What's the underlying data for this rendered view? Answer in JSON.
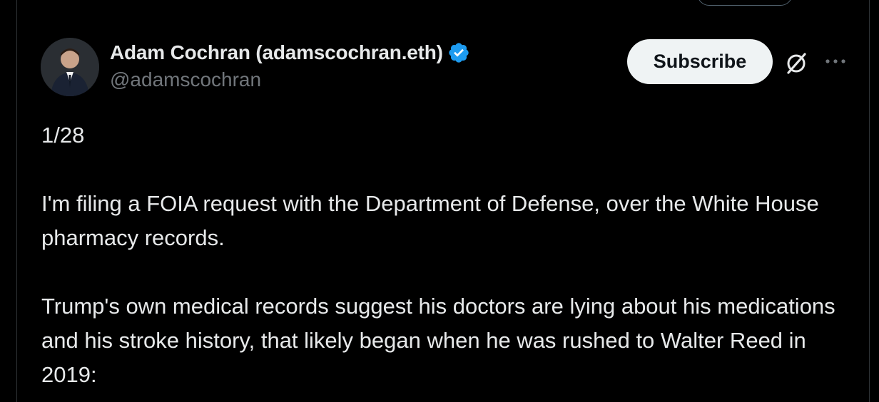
{
  "author": {
    "display_name": "Adam Cochran (adamscochran.eth)",
    "handle": "@adamscochran",
    "verified_icon": "verified-badge-icon",
    "avatar_icon": "avatar"
  },
  "actions": {
    "subscribe_label": "Subscribe",
    "grok_icon": "grok-icon",
    "more_icon": "more-icon"
  },
  "tweet": {
    "counter": "1/28",
    "paragraph_1": "I'm filing a FOIA request with the Department of Defense, over the White House pharmacy records.",
    "paragraph_2": "Trump's own medical records suggest his doctors are lying about his medications and his stroke history, that likely began when he was rushed to Walter Reed in 2019:"
  },
  "colors": {
    "background": "#000000",
    "text_primary": "#e7e9ea",
    "text_secondary": "#71767b",
    "verified_blue": "#1d9bf0",
    "button_bg": "#eff3f4"
  }
}
